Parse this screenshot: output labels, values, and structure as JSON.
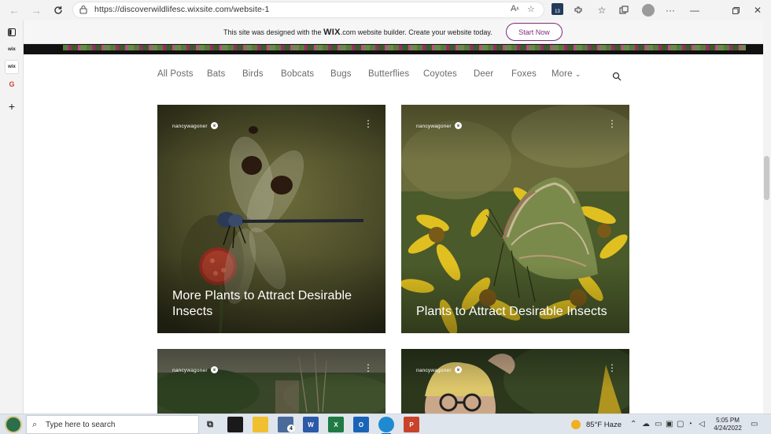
{
  "browser": {
    "url": "https://discoverwildlifesc.wixsite.com/website-1",
    "badge_count": "13"
  },
  "sidebar": {
    "items": [
      "wix",
      "wix",
      "G"
    ]
  },
  "wix_banner": {
    "text_before": "This site was designed with the ",
    "brand": "WIX",
    "text_after": ".com website builder. Create your website today.",
    "button": "Start Now"
  },
  "categories": {
    "items": [
      "All Posts",
      "Bats",
      "Birds",
      "Bobcats",
      "Bugs",
      "Butterflies",
      "Coyotes",
      "Deer",
      "Foxes"
    ],
    "more": "More"
  },
  "posts": [
    {
      "author": "nancywagoner",
      "title": "More Plants to Attract Desirable Insects"
    },
    {
      "author": "nancywagoner",
      "title": "Plants to Attract Desirable Insects"
    },
    {
      "author": "nancywagoner",
      "title": ""
    },
    {
      "author": "nancywagoner",
      "title": ""
    }
  ],
  "taskbar": {
    "search_placeholder": "Type here to search",
    "mail_badge": "4",
    "weather": "85°F  Haze",
    "time": "5:05 PM",
    "date": "4/24/2022"
  },
  "colors": {
    "wix_accent": "#7b2d7b",
    "windows_accent": "#0a64c8"
  }
}
